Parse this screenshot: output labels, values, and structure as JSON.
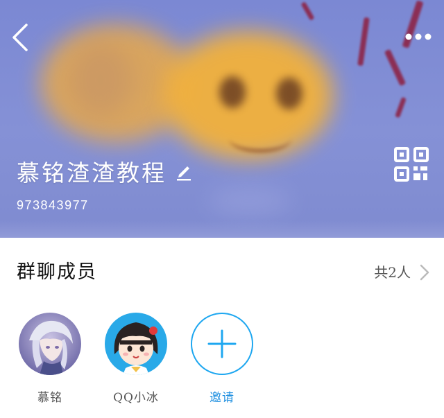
{
  "header": {
    "group_name": "慕铭渣渣教程",
    "group_id": "973843977",
    "icons": {
      "back": "back-arrow-icon",
      "more": "more-dots-icon",
      "edit": "pencil-edit-icon",
      "qr": "qr-code-icon"
    }
  },
  "members": {
    "title": "群聊成员",
    "count": "共2人",
    "items": [
      {
        "name": "慕铭",
        "avatar": "anime-character-avatar"
      },
      {
        "name": "QQ小冰",
        "avatar": "cartoon-girl-avatar"
      }
    ],
    "invite_label": "邀请"
  },
  "colors": {
    "accent": "#1ea7f0",
    "invite_text": "#1e8fe0",
    "header_bg": "#8591d6"
  }
}
